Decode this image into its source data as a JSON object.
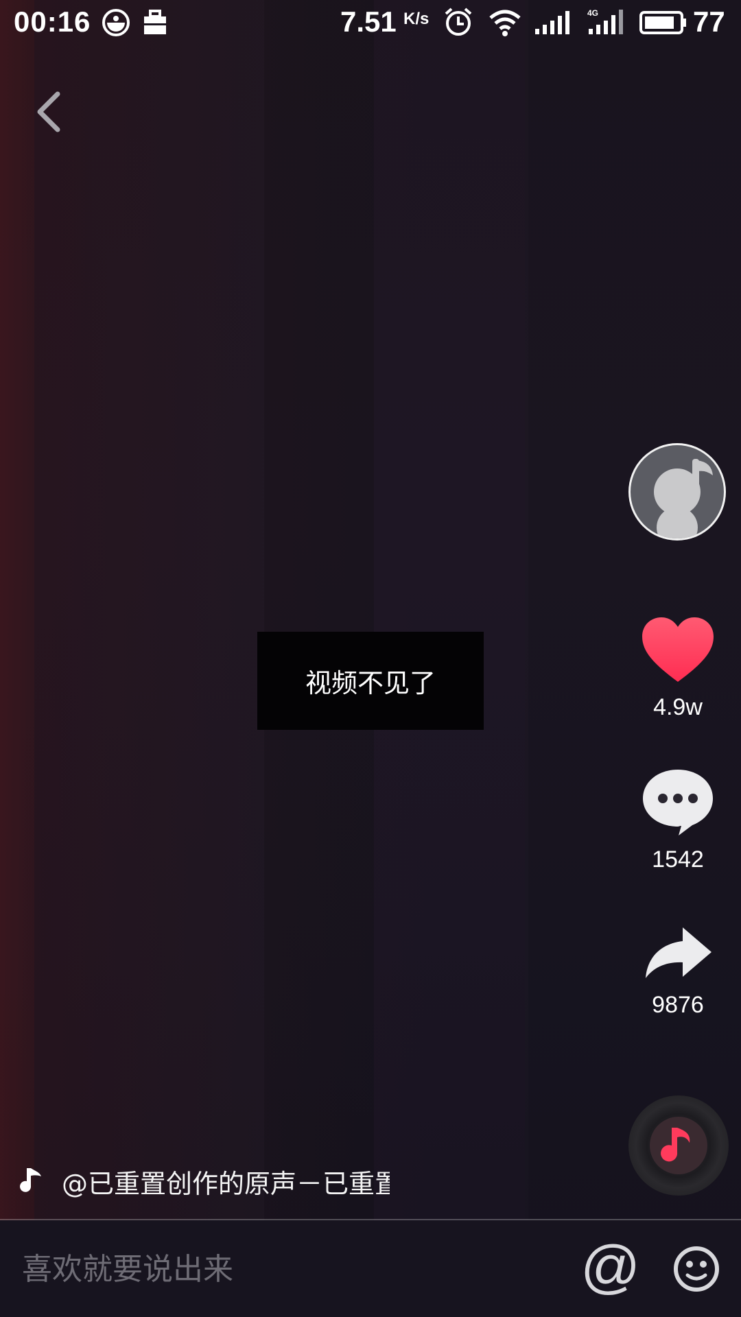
{
  "status_bar": {
    "time": "00:16",
    "net_speed": "7.51",
    "net_speed_unit": "K/s",
    "network_type": "4G",
    "battery": "77"
  },
  "video": {
    "toast_text": "视频不见了"
  },
  "actions": {
    "likes": "4.9w",
    "comments": "1542",
    "shares": "9876"
  },
  "music": {
    "caption": "@已重置创作的原声－已重置"
  },
  "comment_bar": {
    "placeholder": "喜欢就要说出来",
    "mention_label": "@"
  },
  "colors": {
    "like": "#ff3b5c",
    "disc_note": "#ff3b5c"
  }
}
